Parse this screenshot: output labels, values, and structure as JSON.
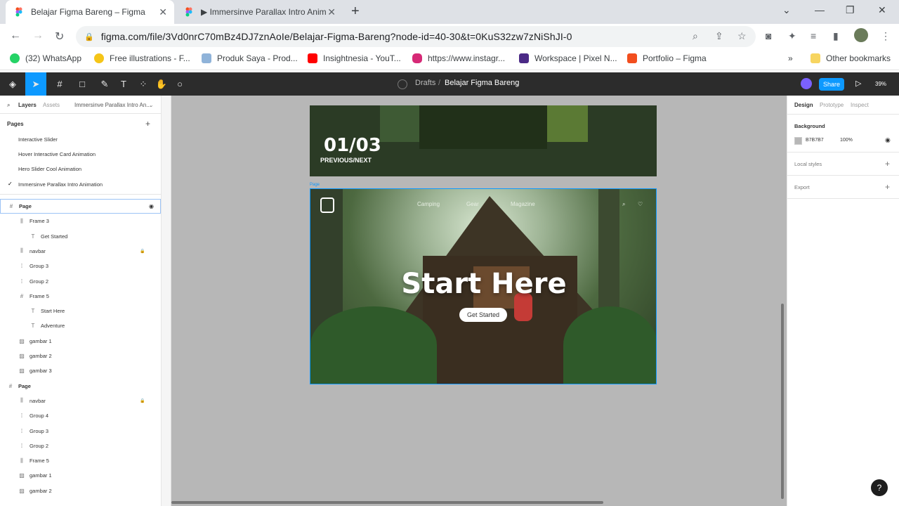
{
  "browser": {
    "tabs": [
      {
        "title": "Belajar Figma Bareng – Figma",
        "active": true
      },
      {
        "title": "▶ Immersinve Parallax Intro Anim",
        "active": false
      }
    ],
    "url": "figma.com/file/3Vd0nrC70mBz4DJ7znAoIe/Belajar-Figma-Bareng?node-id=40-30&t=0KuS32zw7zNiShJI-0",
    "bookmarks": [
      {
        "label": "(32) WhatsApp",
        "color": "#25d366"
      },
      {
        "label": "Free illustrations - F...",
        "color": "#f5c518"
      },
      {
        "label": "Produk Saya - Prod...",
        "color": "#8fb3d9"
      },
      {
        "label": "Insightnesia - YouT...",
        "color": "#ff0000"
      },
      {
        "label": "https://www.instagr...",
        "color": "#d62976"
      },
      {
        "label": "Workspace | Pixel N...",
        "color": "#4b2a86"
      },
      {
        "label": "Portfolio – Figma",
        "color": "#f24e1e"
      }
    ],
    "more_bookmarks": "»",
    "other_bookmarks": "Other bookmarks"
  },
  "figma": {
    "breadcrumb_parent": "Drafts",
    "breadcrumb_sep": "/",
    "file_name": "Belajar Figma Bareng",
    "share_label": "Share",
    "zoom": "39%",
    "left_tabs": {
      "layers": "Layers",
      "assets": "Assets",
      "page_name": "Immersinve Parallax Intro An..."
    },
    "pages_heading": "Pages",
    "pages": [
      "Interactive Slider",
      "Hover Interactive Card Animation",
      "Hero Slider Cool Animation",
      "Immersinve Parallax Intro Animation"
    ],
    "layers": [
      {
        "icon": "#",
        "label": "Page",
        "indent": 0,
        "selected": true
      },
      {
        "icon": "⫼",
        "label": "Frame 3",
        "indent": 1
      },
      {
        "icon": "T",
        "label": "Get Started",
        "indent": 2
      },
      {
        "icon": "⫼",
        "label": "navbar",
        "indent": 1,
        "locked": true
      },
      {
        "icon": "⁞",
        "label": "Group 3",
        "indent": 1
      },
      {
        "icon": "⁞",
        "label": "Group 2",
        "indent": 1
      },
      {
        "icon": "#",
        "label": "Frame 5",
        "indent": 1
      },
      {
        "icon": "T",
        "label": "Start Here",
        "indent": 2
      },
      {
        "icon": "T",
        "label": "Adventure",
        "indent": 2
      },
      {
        "icon": "▨",
        "label": "gambar 1",
        "indent": 1
      },
      {
        "icon": "▨",
        "label": "gambar 2",
        "indent": 1
      },
      {
        "icon": "▨",
        "label": "gambar 3",
        "indent": 1
      },
      {
        "icon": "#",
        "label": "Page",
        "indent": 0
      },
      {
        "icon": "⫼",
        "label": "navbar",
        "indent": 1,
        "locked": true
      },
      {
        "icon": "⁞",
        "label": "Group 4",
        "indent": 1
      },
      {
        "icon": "⁞",
        "label": "Group 3",
        "indent": 1
      },
      {
        "icon": "⁞",
        "label": "Group 2",
        "indent": 1
      },
      {
        "icon": "⫼",
        "label": "Frame 5",
        "indent": 1
      },
      {
        "icon": "▨",
        "label": "gambar 1",
        "indent": 1
      },
      {
        "icon": "▨",
        "label": "gambar 2",
        "indent": 1
      }
    ],
    "canvas": {
      "slide_counter": "01/03",
      "slide_nav": "PREVIOUS/NEXT",
      "frame_label": "Page",
      "hero_nav": [
        "Camping",
        "Gear",
        "Magazine"
      ],
      "headline": "Start Here",
      "cta": "Get Started"
    },
    "right_tabs": {
      "design": "Design",
      "prototype": "Prototype",
      "inspect": "Inspect"
    },
    "background_heading": "Background",
    "background_hex": "B7B7B7",
    "background_opacity": "100%",
    "local_styles": "Local styles",
    "export": "Export",
    "help": "?"
  },
  "colors": {
    "figma_blue": "#0d99ff",
    "canvas_bg": "#b7b7b7",
    "toolbar": "#2c2c2c"
  }
}
